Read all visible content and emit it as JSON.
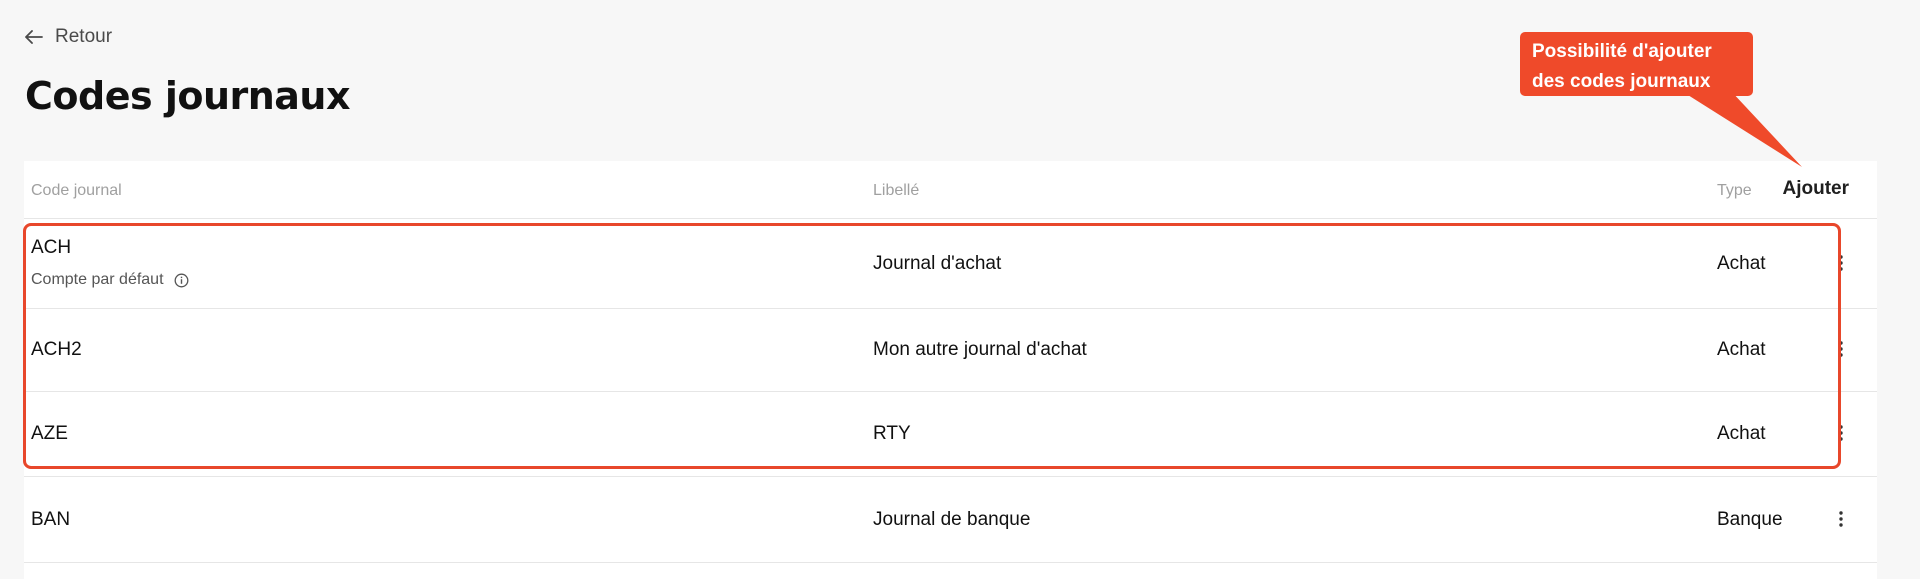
{
  "nav": {
    "back_label": "Retour"
  },
  "page": {
    "title": "Codes journaux"
  },
  "table": {
    "columns": {
      "code": "Code journal",
      "label": "Libellé",
      "type": "Type"
    },
    "add_label": "Ajouter",
    "rows": [
      {
        "code": "ACH",
        "sub": "Compte par défaut",
        "label": "Journal d'achat",
        "type": "Achat"
      },
      {
        "code": "ACH2",
        "label": "Mon autre journal d'achat",
        "type": "Achat"
      },
      {
        "code": "AZE",
        "label": "RTY",
        "type": "Achat"
      },
      {
        "code": "BAN",
        "label": "Journal de banque",
        "type": "Banque"
      }
    ]
  },
  "annotation": {
    "line1": "Possibilité d'ajouter",
    "line2": "des codes journaux",
    "color": "#ef4a2a"
  }
}
